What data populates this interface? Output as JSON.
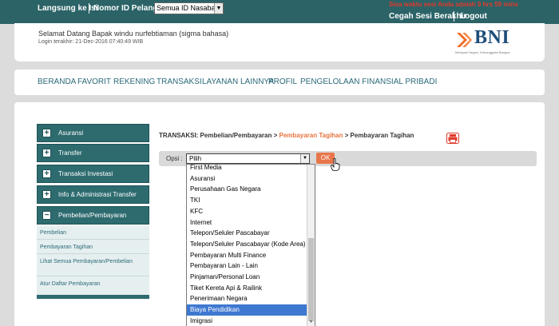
{
  "topbar": {
    "language_label": "Langsung ke Isi",
    "customer_id_label": "Nomor ID Pelanggan :",
    "customer_select_value": "Semua ID Nasabah",
    "session_timer": "Sisa waktu sesi Anda adalah 9 hrs 59 mins",
    "end_session": "Cegah Sesi Berakhir",
    "logout": "Logout"
  },
  "greeting": {
    "welcome": "Selamat Datang Bapak  windu  nurfebtiaman  (sigma bahasa)",
    "last_login": "Login terakhir:  21-Dec-2016 07:40:49  WIB"
  },
  "logo": {
    "word": "BNI",
    "tagline": "Melayani Negeri, Kebanggaan Bangsa"
  },
  "nav": {
    "items": [
      "BERANDA",
      "FAVORIT",
      "REKENING",
      "TRANSAKSI",
      "LAYANAN LAINNYA",
      "PROFIL",
      "PENGELOLAAN FINANSIAL PRIBADI"
    ]
  },
  "sidebar": {
    "menus": [
      "Asuransi",
      "Transfer",
      "Transaksi Investasi",
      "Info & Administrasi Transfer",
      "Pembelian/Pembayaran"
    ],
    "expanded_symbol": "−",
    "collapsed_symbol": "+",
    "submenu": [
      "Pembelian",
      "Pembayaran Tagihan",
      "Lihat Semua Pembayaran/Pembelian",
      "Atur Daftar Pembayaran"
    ]
  },
  "breadcrumb": {
    "prefix": "TRANSAKSI: Pembelian/Pembayaran >",
    "link": "Pembayaran Tagihan",
    "suffix": "> Pembayaran Tagihan"
  },
  "form": {
    "opsi_label": "Opsi :",
    "select_value": "Pilih",
    "ok_label": "OK"
  },
  "dropdown": {
    "selected_index": 13,
    "options": [
      "First Media",
      "Asuransi",
      "Perusahaan Gas Negara",
      "TKI",
      "KFC",
      "Internet",
      "Telepon/Seluler Pascabayar",
      "Telepon/Seluler Pascabayar (Kode Area)",
      "Pembayaran Multi Finance",
      "Pembayaran Lain - Lain",
      "Pinjaman/Personal Loan",
      "Tiket Kereta Api & Railink",
      "Penerimaan Negara",
      "Biaya Pendidikan",
      "Imigrasi"
    ]
  },
  "colors": {
    "topbar": "#2b6367",
    "nav_text": "#2b6a79",
    "accent_orange": "#e8764a",
    "selection_blue": "#3e78d1"
  }
}
